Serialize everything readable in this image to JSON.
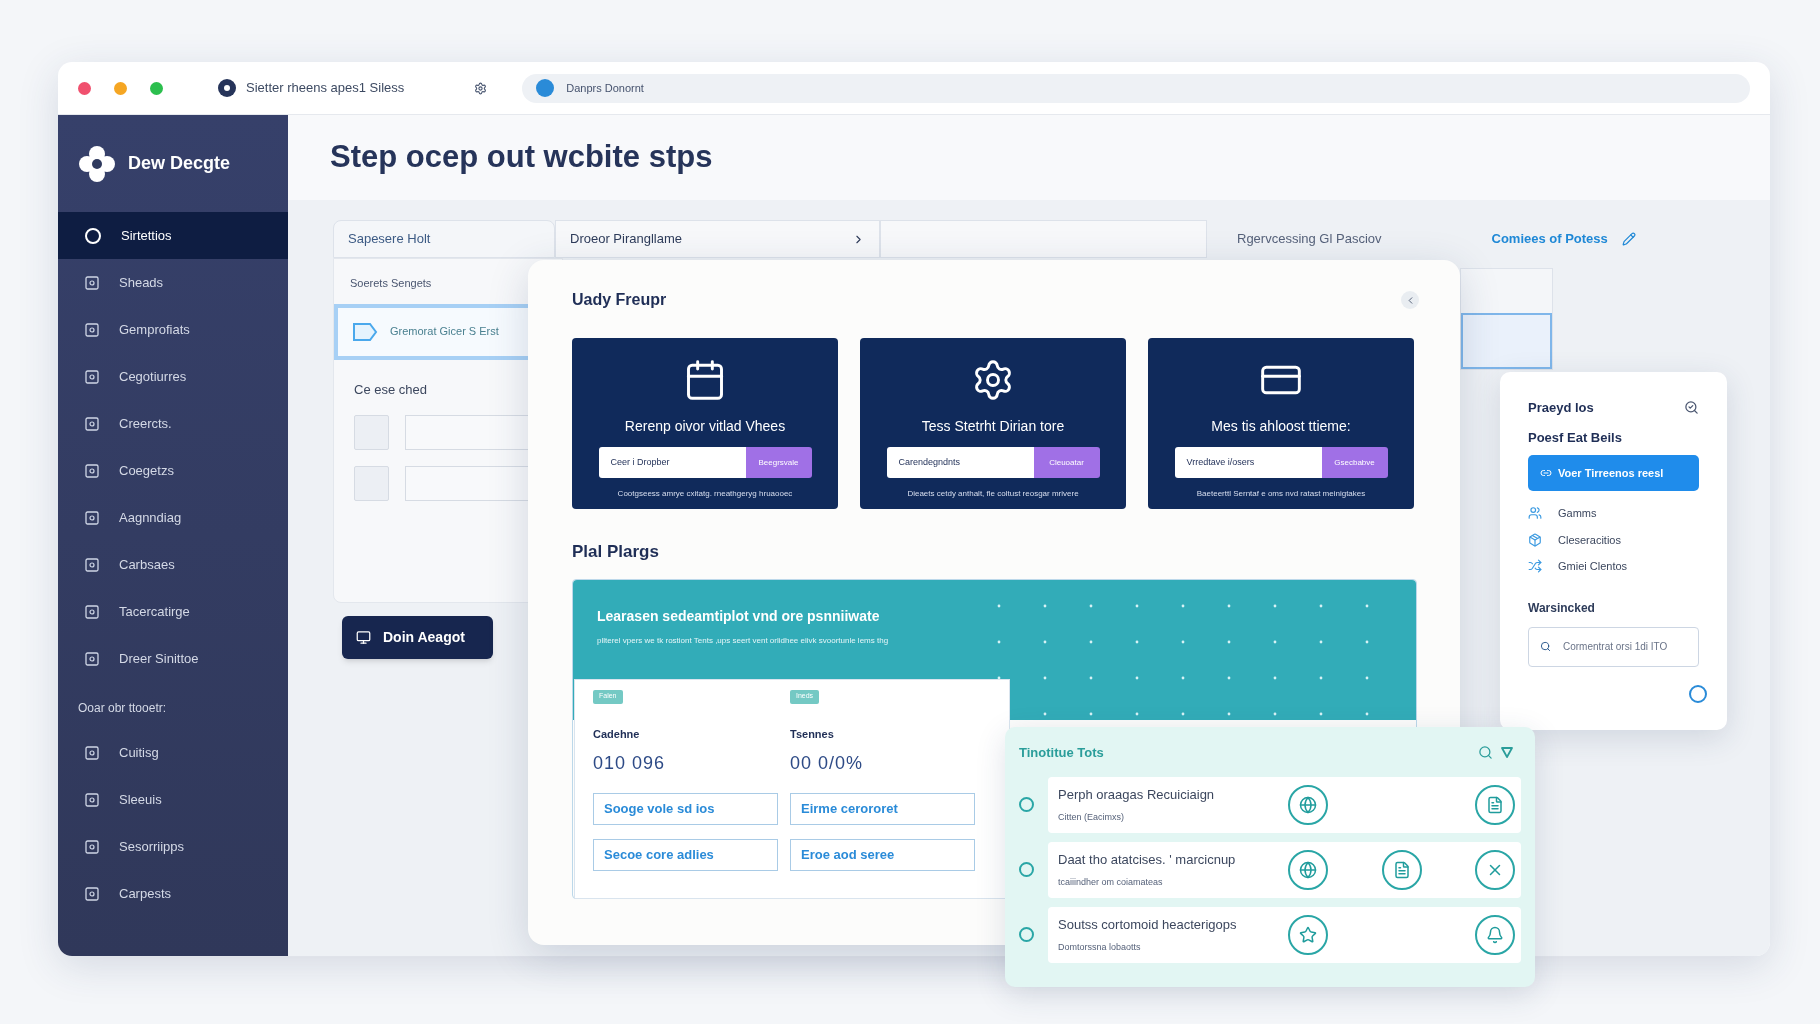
{
  "browser": {
    "tab_title": "Sietter rheens apes1 Siless",
    "address": "Danprs Donornt"
  },
  "sidebar": {
    "brand": "Dew Decgte",
    "items": [
      {
        "label": "Sirtettios",
        "selected": true
      },
      {
        "label": "Sheads",
        "selected": false
      },
      {
        "label": "Gemprofiats",
        "selected": false
      },
      {
        "label": "Cegotiurres",
        "selected": false
      },
      {
        "label": "Creercts.",
        "selected": false
      },
      {
        "label": "Coegetzs",
        "selected": false
      },
      {
        "label": "Aagnndiag",
        "selected": false
      },
      {
        "label": "Carbsaes",
        "selected": false
      },
      {
        "label": "Tacercatirge",
        "selected": false
      },
      {
        "label": "Dreer Sinittoe",
        "selected": false
      }
    ],
    "section_label": "Ooar obr ttooetr:",
    "section_items": [
      {
        "label": "Cuitisg",
        "selected": false
      },
      {
        "label": "Sleeuis",
        "selected": false
      },
      {
        "label": "Sesorriipps",
        "selected": false
      },
      {
        "label": "Carpests",
        "selected": false
      }
    ]
  },
  "page_title": "Step ocep out wcbite stps",
  "tabs": [
    {
      "kind": "tab",
      "label": "Sapesere Holt"
    },
    {
      "kind": "select",
      "label": "Droeor Pirangllame"
    },
    {
      "kind": "blank"
    },
    {
      "kind": "plain",
      "label": "Rgervcessing Gl Pasciov"
    }
  ],
  "header_link": "Comiees of Potess",
  "settings_card": {
    "title": "Soerets Sengets",
    "highlight": "Gremorat Gicer S Erst",
    "section": "Ce ese ched",
    "rows": [
      {
        "checked": false
      },
      {
        "checked": false
      }
    ]
  },
  "primary_button": "Doin Aeagot",
  "modal": {
    "title": "Uady Freupr",
    "cards": [
      {
        "title": "Rerenp oivor vitlad Vhees",
        "value": "Ceer i Dropber",
        "button": "Beegrsvale",
        "note": "Cootgseess amrye cxitatg. rneathgeryg hruaooec"
      },
      {
        "title": "Tess Stetrht Dirian tore",
        "value": "Carendegndnts",
        "button": "Cleuoatar",
        "note": "Dieaets cetdy anthalt, fle coltust reosgar mrivere"
      },
      {
        "title": "Mes tis ahloost ttieme:",
        "value": "Vrredtave i/osers",
        "button": "Gsecbabve",
        "note": "Baeteerttl Serntaf e oms nvd ratast meinigtakes"
      }
    ],
    "plans_title": "Plal Plargs",
    "banner": {
      "title": "Learasen sedeamtiplot vnd ore psnniiwate",
      "subtitle": "pllterel vpers we tk rostiont Tents ,ups seert vent orlidhee eiivk svoortunle lems thg"
    },
    "tiles": [
      {
        "badge": "Falen",
        "label": "Cadehne",
        "value": "010 096",
        "buttons": [
          "Sooge vole sd ios",
          "Secoe core adlies"
        ]
      },
      {
        "badge": "Ineds",
        "label": "Tsennes",
        "value": "00 0/0%",
        "buttons": [
          "Eirme cerororet",
          "Eroe aod seree"
        ]
      }
    ]
  },
  "right_panel": {
    "title": "Praeyd los",
    "subtitle": "Poesf Eat Beils",
    "button": "Voer Tirreenos reesl",
    "items": [
      "Gamms",
      "Cleseracitios",
      "Gmiei Clentos"
    ],
    "section": "Warsincked",
    "search_placeholder": "Cormentrat orsi 1di ITO",
    "radio_selected": false
  },
  "list_panel": {
    "title": "Tinotitue Tots",
    "rows": [
      {
        "title": "Perph oraagas Recuiciaign",
        "subtitle": "Citten (Eacimxs)",
        "selected": false
      },
      {
        "title": "Daat tho atatcises. ' marcicnup",
        "subtitle": "tcaiiindher om coiamateas",
        "selected": false
      },
      {
        "title": "Soutss cortomoid heacterigops",
        "subtitle": "Domtorssna lobaotts",
        "selected": false
      }
    ]
  }
}
